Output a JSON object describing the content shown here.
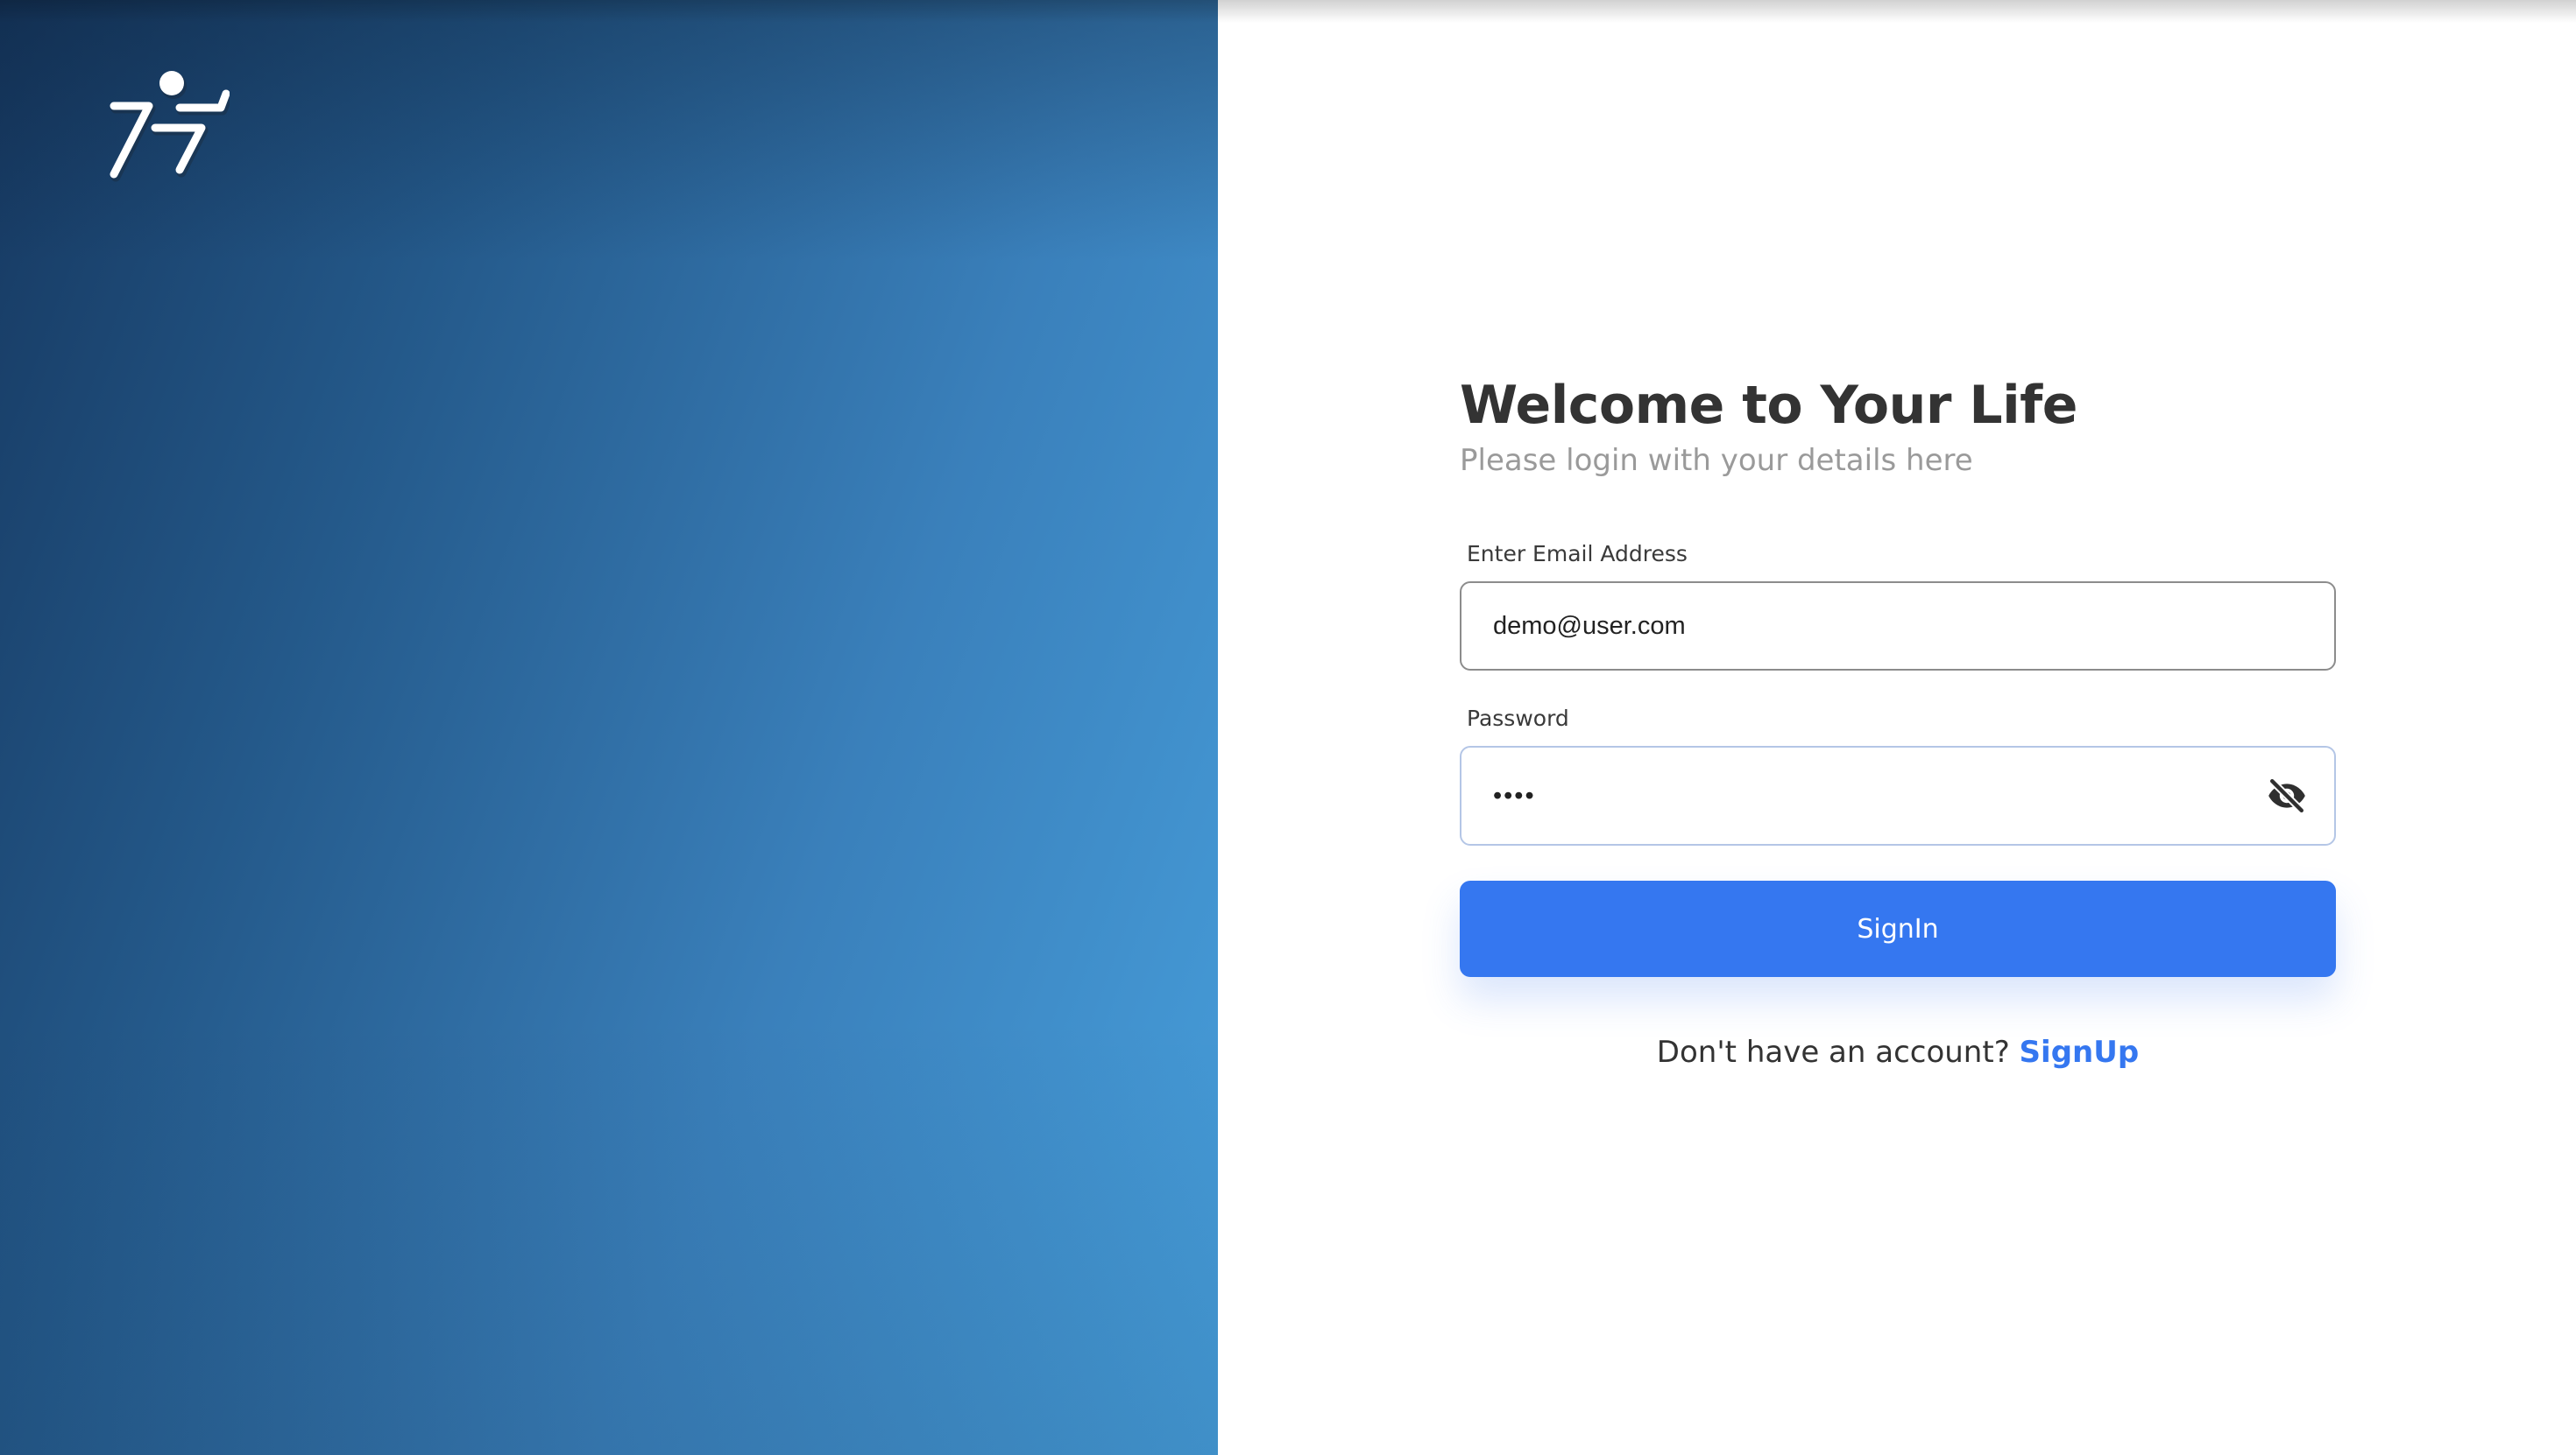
{
  "app": {
    "logo_icon": "running-person-icon"
  },
  "login": {
    "title": "Welcome to Your Life",
    "subtitle": "Please login with your details here",
    "email_label": "Enter Email Address",
    "email_value": "demo@user.com",
    "password_label": "Password",
    "password_value": "demo",
    "password_toggle_icon": "eye-off-icon",
    "signin_label": "SignIn",
    "signup_prompt": "Don't have an account?",
    "signup_link": "SignUp"
  },
  "colors": {
    "accent": "#3577f0",
    "heading": "#333333",
    "subtitle": "#9a9a9a",
    "panel_gradient_start": "#163860",
    "panel_gradient_end": "#479fdc"
  }
}
